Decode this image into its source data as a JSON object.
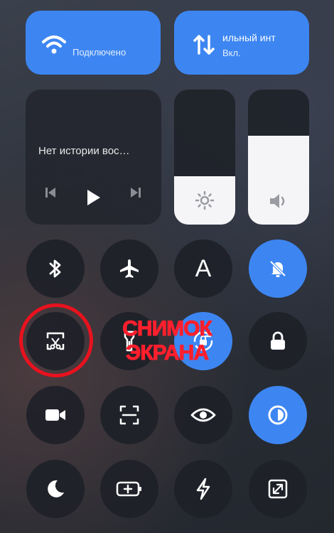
{
  "quick_tiles": {
    "wifi": {
      "status": "Подключено",
      "icon": "wifi-icon"
    },
    "mobile_data": {
      "title": "ильный инт",
      "status": "Вкл.",
      "icon": "data-transfer-icon"
    }
  },
  "media": {
    "title": "Нет истории вос…",
    "controls": [
      "previous-icon",
      "play-icon",
      "next-icon"
    ]
  },
  "sliders": {
    "brightness": {
      "icon": "brightness-icon",
      "level_percent": 36
    },
    "volume": {
      "icon": "volume-icon",
      "level_percent": 66
    }
  },
  "toggles": [
    {
      "name": "bluetooth",
      "icon": "bluetooth-icon",
      "active": false
    },
    {
      "name": "airplane-mode",
      "icon": "airplane-icon",
      "active": false
    },
    {
      "name": "font-size",
      "icon": "text-a-icon",
      "label": "A",
      "active": false
    },
    {
      "name": "silent-mode",
      "icon": "bell-off-icon",
      "active": true
    },
    {
      "name": "screenshot",
      "icon": "screenshot-icon",
      "active": false
    },
    {
      "name": "flashlight",
      "icon": "flashlight-icon",
      "active": false
    },
    {
      "name": "rotation-lock",
      "icon": "rotation-lock-icon",
      "active": true
    },
    {
      "name": "lock-screen",
      "icon": "lock-icon",
      "active": false
    },
    {
      "name": "screen-recorder",
      "icon": "video-camera-icon",
      "active": false
    },
    {
      "name": "scanner",
      "icon": "scan-icon",
      "active": false
    },
    {
      "name": "reading-mode",
      "icon": "eye-icon",
      "active": false
    },
    {
      "name": "dark-mode",
      "icon": "dark-mode-icon",
      "active": true
    },
    {
      "name": "do-not-disturb",
      "icon": "moon-icon",
      "active": false
    },
    {
      "name": "battery-saver",
      "icon": "battery-icon",
      "active": false
    },
    {
      "name": "power-mode",
      "icon": "lightning-icon",
      "active": false
    },
    {
      "name": "floating-window",
      "icon": "expand-icon",
      "active": false
    }
  ],
  "annotation": {
    "line1": "СНИМОК",
    "line2": "ЭКРАНА",
    "color": "#ff1f2d"
  },
  "colors": {
    "accent": "#3d86f2",
    "tile_dark": "#23262d",
    "highlight": "#e8121e"
  }
}
